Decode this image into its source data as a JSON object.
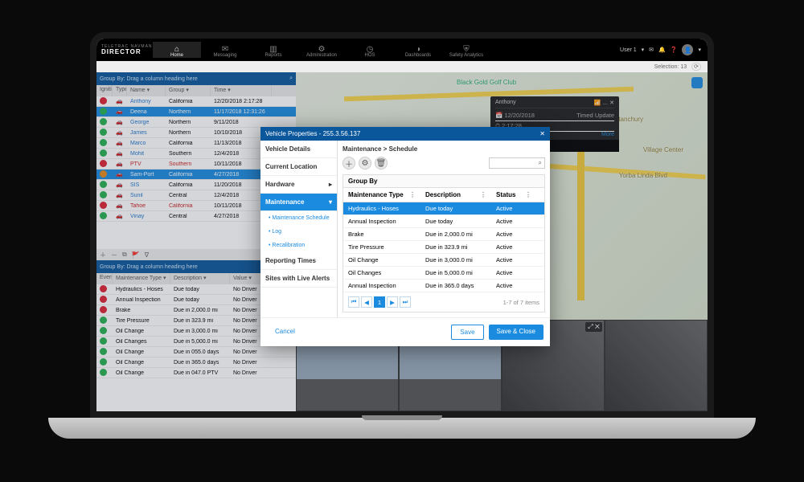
{
  "brand": {
    "line1": "TELETRAC NAVMAN",
    "line2": "DIRECTOR"
  },
  "nav": {
    "items": [
      {
        "icon": "⌂",
        "label": "Home",
        "active": true
      },
      {
        "icon": "✉",
        "label": "Messaging"
      },
      {
        "icon": "▥",
        "label": "Reports"
      },
      {
        "icon": "⚙",
        "label": "Administration"
      },
      {
        "icon": "◷",
        "label": "HOS"
      },
      {
        "icon": "◑",
        "label": "Dashboards"
      },
      {
        "icon": "⛨",
        "label": "Safety Analytics"
      }
    ],
    "user": "User 1"
  },
  "secondbar": {
    "selection": "Selection: 13"
  },
  "leftGrid": {
    "groupByText": "Group By: Drag a column heading here",
    "searchIcon": "⌕",
    "headers": [
      "Ignition",
      "Type",
      "Name",
      "Group",
      "Time"
    ],
    "rows": [
      {
        "dot": "red",
        "name": "Anthony",
        "group": "California",
        "time": "12/20/2018 2:17:28",
        "sel": false
      },
      {
        "dot": "green",
        "name": "Deena",
        "group": "Northern",
        "time": "11/17/2018 12:31:26",
        "sel": true
      },
      {
        "dot": "green",
        "name": "George",
        "group": "Northern",
        "time": "9/11/2018",
        "sel": false
      },
      {
        "dot": "green",
        "name": "James",
        "group": "Northern",
        "time": "10/10/2018",
        "sel": false
      },
      {
        "dot": "green",
        "name": "Marco",
        "group": "California",
        "time": "11/13/2018",
        "sel": false
      },
      {
        "dot": "green",
        "name": "Mohit",
        "group": "Southern",
        "time": "12/4/2018",
        "sel": false
      },
      {
        "dot": "red",
        "name": "PTV",
        "group": "Southern",
        "time": "10/11/2018",
        "sel": false,
        "nameRed": true
      },
      {
        "dot": "orange",
        "name": "Sam-Port",
        "group": "California",
        "time": "4/27/2018",
        "sel": true
      },
      {
        "dot": "green",
        "name": "SIS",
        "group": "California",
        "time": "11/20/2018",
        "sel": false
      },
      {
        "dot": "green",
        "name": "Sunil",
        "group": "Central",
        "time": "12/4/2018",
        "sel": false
      },
      {
        "dot": "red",
        "name": "Tahoe",
        "group": "California",
        "time": "10/11/2018",
        "sel": false,
        "nameRed": true
      },
      {
        "dot": "green",
        "name": "Vinay",
        "group": "Central",
        "time": "4/27/2018",
        "sel": false,
        "nameBlue": true
      }
    ]
  },
  "lowerGrid": {
    "groupByText": "Group By: Drag a column heading here",
    "headers": [
      "Event",
      "Maintenance Type",
      "Description",
      "Value"
    ],
    "rows": [
      {
        "dot": "red",
        "mt": "Hydraulics - Hoses",
        "desc": "Due today",
        "val": "No Driver"
      },
      {
        "dot": "red",
        "mt": "Annual Inspection",
        "desc": "Due today",
        "val": "No Driver"
      },
      {
        "dot": "red",
        "mt": "Brake",
        "desc": "Due in 2,000.0 mi",
        "val": "No Driver"
      },
      {
        "dot": "green",
        "mt": "Tire Pressure",
        "desc": "Due in 323.9 mi",
        "val": "No Driver"
      },
      {
        "dot": "green",
        "mt": "Oil Change",
        "desc": "Due in 3,000.0 mi",
        "val": "No Driver"
      },
      {
        "dot": "green",
        "mt": "Oil Changes",
        "desc": "Due in 5,000.0 mi",
        "val": "No Driver"
      },
      {
        "dot": "green",
        "mt": "Oil Change",
        "desc": "Due in 055.0 days",
        "val": "No Driver"
      },
      {
        "dot": "green",
        "mt": "Oil Change",
        "desc": "Due in 365.0 days",
        "val": "No Driver"
      },
      {
        "dot": "green",
        "mt": "Oil Change",
        "desc": "Due in 047.0 PTV",
        "val": "No Driver"
      }
    ]
  },
  "map": {
    "poi": "Black Gold Golf Club",
    "label2": "Yorba Linda Blvd",
    "label3": "Bastanchury",
    "label4": "Village Center"
  },
  "minipop": {
    "title": "Anthony",
    "date": "12/20/2018",
    "time": "2:17:28",
    "status": "Timed Update",
    "more": "More"
  },
  "thumbs": {
    "expand": "⤢",
    "close": "✕"
  },
  "modal": {
    "title": "Vehicle Properties - 255.3.56.137",
    "side": [
      {
        "label": "Vehicle Details"
      },
      {
        "label": "Current Location"
      },
      {
        "label": "Hardware",
        "caret": true
      },
      {
        "label": "Maintenance",
        "active": true,
        "caret": true
      }
    ],
    "subs": [
      {
        "label": "Maintenance Schedule",
        "bullet": true
      },
      {
        "label": "Log",
        "bullet": true
      },
      {
        "label": "Recalibration",
        "bullet": true
      }
    ],
    "sideTail": [
      {
        "label": "Reporting Times"
      },
      {
        "label": "Sites with Live Alerts"
      }
    ],
    "breadcrumb": "Maintenance > Schedule",
    "toolbar": {
      "add": "＋",
      "settings": "⚙",
      "delete": "🗑"
    },
    "groupBy": "Group By",
    "cols": [
      "Maintenance Type",
      "Description",
      "Status"
    ],
    "rows": [
      {
        "mt": "Hydraulics - Hoses",
        "desc": "Due today",
        "st": "Active",
        "sel": true
      },
      {
        "mt": "Annual Inspection",
        "desc": "Due today",
        "st": "Active"
      },
      {
        "mt": "Brake",
        "desc": "Due in 2,000.0 mi",
        "st": "Active"
      },
      {
        "mt": "Tire Pressure",
        "desc": "Due in 323.9 mi",
        "st": "Active"
      },
      {
        "mt": "Oil Change",
        "desc": "Due in 3,000.0 mi",
        "st": "Active"
      },
      {
        "mt": "Oil Changes",
        "desc": "Due in 5,000.0 mi",
        "st": "Active"
      },
      {
        "mt": "Annual Inspection",
        "desc": "Due in 365.0 days",
        "st": "Active"
      }
    ],
    "pager": {
      "info": "1-7 of 7 items",
      "page": "1"
    },
    "footer": {
      "cancel": "Cancel",
      "save": "Save",
      "saveClose": "Save & Close"
    }
  }
}
